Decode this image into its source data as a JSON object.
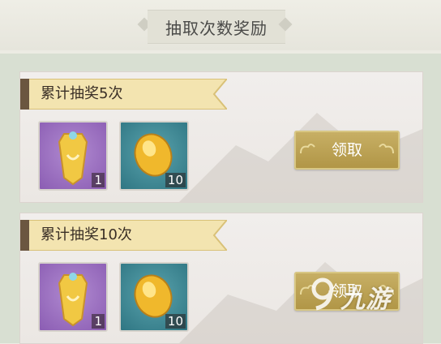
{
  "header": {
    "title": "抽取次数奖励"
  },
  "cards": [
    {
      "label": "累计抽奖5次",
      "items": [
        {
          "icon": "golden-cape-icon",
          "count": "1"
        },
        {
          "icon": "gold-ingot-icon",
          "count": "10"
        }
      ],
      "button": "领取"
    },
    {
      "label": "累计抽奖10次",
      "items": [
        {
          "icon": "golden-cape-icon",
          "count": "1"
        },
        {
          "icon": "gold-ingot-icon",
          "count": "10"
        }
      ],
      "button": "领取"
    }
  ],
  "watermark": {
    "text": "九游"
  },
  "colors": {
    "button": "#b9a04f",
    "ribbon": "#f3e4b0",
    "item_purple": "#9a6cc1",
    "item_teal": "#3f8893"
  }
}
